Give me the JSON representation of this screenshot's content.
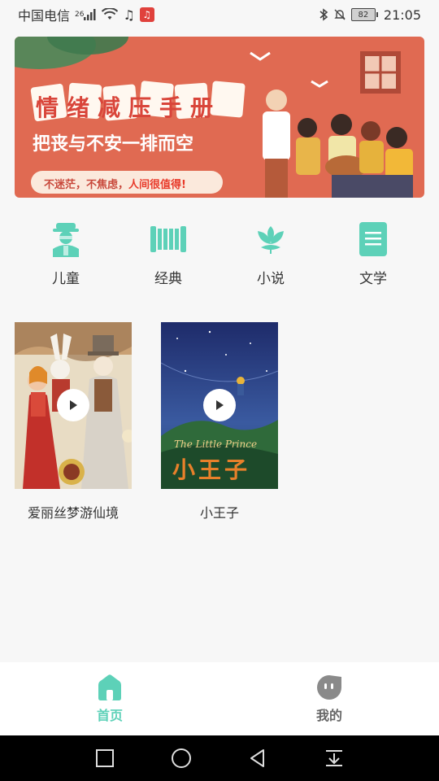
{
  "status_bar": {
    "carrier": "中国电信",
    "network": "26",
    "battery": "82",
    "time": "21:05"
  },
  "banner": {
    "title": "情绪减压手册",
    "subtitle": "把丧与不安一排而空",
    "tagline_prefix": "不迷茫，不焦虑，",
    "tagline_highlight": "人间很值得!"
  },
  "categories": [
    {
      "label": "儿童",
      "icon": "child-icon"
    },
    {
      "label": "经典",
      "icon": "scroll-icon"
    },
    {
      "label": "小说",
      "icon": "lotus-icon"
    },
    {
      "label": "文学",
      "icon": "document-icon"
    }
  ],
  "books": [
    {
      "title": "爱丽丝梦游仙境",
      "cover_text": ""
    },
    {
      "title": "小王子",
      "cover_text_en": "The Little Prince",
      "cover_text_cn": "小王子"
    }
  ],
  "bottom_nav": {
    "home": "首页",
    "mine": "我的"
  },
  "colors": {
    "accent": "#5dd1b8",
    "banner_bg": "#e06a52"
  }
}
